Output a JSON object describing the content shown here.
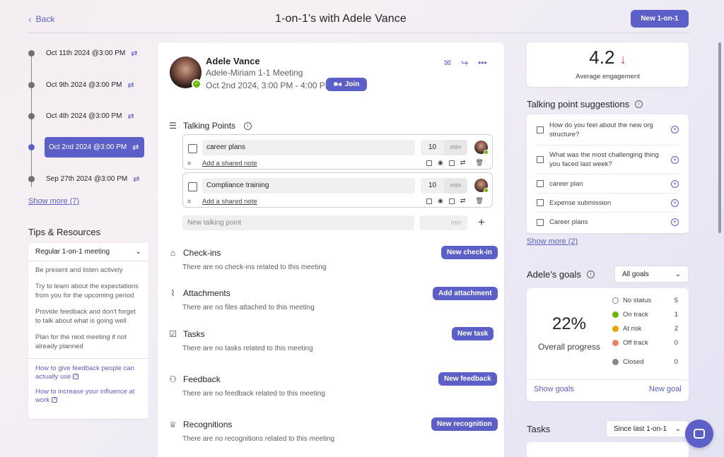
{
  "header": {
    "back_label": "Back",
    "title": "1-on-1's with Adele Vance",
    "new_button": "New 1-on-1"
  },
  "timeline": {
    "items": [
      {
        "label": "Oct 11th 2024 @3:00 PM",
        "active": false
      },
      {
        "label": "Oct 9th 2024 @3:00 PM",
        "active": false
      },
      {
        "label": "Oct 4th 2024 @3:00 PM",
        "active": false
      },
      {
        "label": "Oct 2nd 2024 @3:00 PM",
        "active": true
      },
      {
        "label": "Sep 27th 2024 @3:00 PM",
        "active": false
      }
    ],
    "show_more": "Show more (7)"
  },
  "tips": {
    "title": "Tips & Resources",
    "selected_type": "Regular 1-on-1 meeting",
    "items": [
      "Be present and listen actively",
      "Try to learn about the expectations from you for the upcoming period",
      "Provide feedback and don't forget to talk about what is going well",
      "Plan for the next meeting if not already planned"
    ],
    "links": [
      "How to give feedback people can actually use",
      "How to increase your influence at work"
    ]
  },
  "meeting": {
    "person_name": "Adele Vance",
    "meeting_name": "Adele-Miriam 1-1 Meeting",
    "time": "Oct 2nd 2024, 3:00 PM - 4:00 PM",
    "join_label": "Join"
  },
  "talking_points": {
    "title": "Talking Points",
    "items": [
      {
        "title": "career plans",
        "minutes": "10",
        "unit": "min",
        "note": "Add a shared note"
      },
      {
        "title": "Compliance training",
        "minutes": "10",
        "unit": "min",
        "note": "Add a shared note"
      }
    ],
    "new_placeholder": "New talking point",
    "new_unit": "min"
  },
  "sections": {
    "checkins": {
      "title": "Check-ins",
      "empty": "There are no check-ins related to this meeting",
      "button": "New check-in"
    },
    "attachments": {
      "title": "Attachments",
      "empty": "There are no files attached to this meeting",
      "button": "Add attachment"
    },
    "tasks": {
      "title": "Tasks",
      "empty": "There are no tasks related to this meeting",
      "button": "New task"
    },
    "feedback": {
      "title": "Feedback",
      "empty": "There are no feedback related to this meeting",
      "button": "New feedback"
    },
    "recognitions": {
      "title": "Recognitions",
      "empty": "There are no recognitions related to this meeting",
      "button": "New recognition"
    }
  },
  "engagement": {
    "value": "4.2",
    "trend": "down",
    "label": "Average engagement"
  },
  "suggestions": {
    "title": "Talking point suggestions",
    "items": [
      "How do you feel about the new org structure?",
      "What was the most challenging thing you faced last week?",
      "career plan",
      "Expense submission",
      "Career plans"
    ],
    "show_more": "Show more (2)"
  },
  "goals": {
    "title": "Adele's goals",
    "filter": "All goals",
    "percent": "22%",
    "progress_label": "Overall progress",
    "statuses": [
      {
        "name": "No status",
        "count": "5",
        "color": "#ffffff"
      },
      {
        "name": "On track",
        "count": "1",
        "color": "#6bb700"
      },
      {
        "name": "At risk",
        "count": "2",
        "color": "#eaa300"
      },
      {
        "name": "Off track",
        "count": "0",
        "color": "#e9835e"
      },
      {
        "name": "Closed",
        "count": "0",
        "color": "#8a8886"
      }
    ],
    "show_goals": "Show goals",
    "new_goal": "New goal"
  },
  "tasks_panel": {
    "title": "Tasks",
    "filter": "Since last 1-on-1"
  },
  "colors": {
    "accent": "#5b5fc7",
    "engagement_down": "#d13438"
  }
}
